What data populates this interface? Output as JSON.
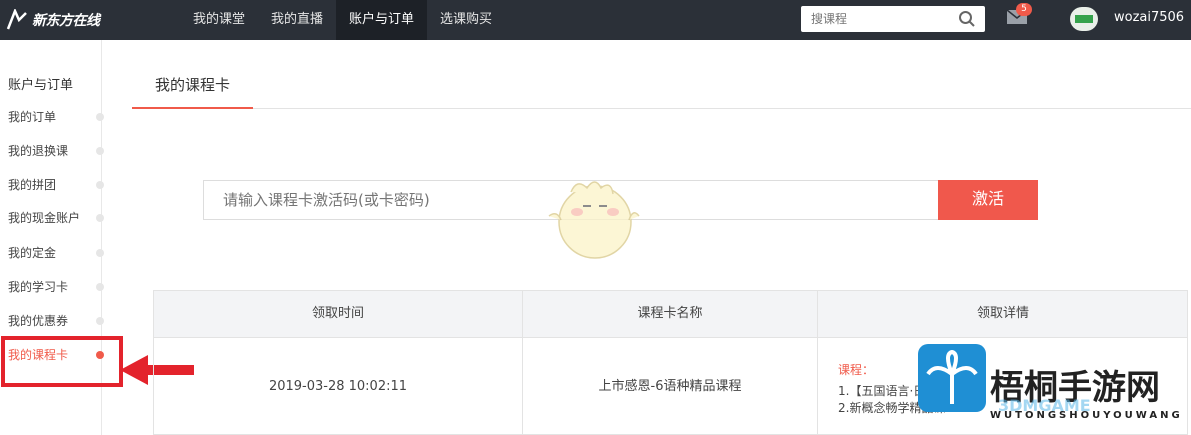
{
  "header": {
    "logo_text": "新东方在线",
    "nav": [
      "我的课堂",
      "我的直播",
      "账户与订单",
      "选课购买"
    ],
    "active_nav_index": 2,
    "search_placeholder": "搜课程",
    "mail_badge": "5",
    "username": "wozai7506"
  },
  "sidebar": {
    "title": "账户与订单",
    "items": [
      "我的订单",
      "我的退换课",
      "我的拼团",
      "我的现金账户",
      "我的定金",
      "我的学习卡",
      "我的优惠券",
      "我的课程卡"
    ],
    "active_index": 7
  },
  "main": {
    "tab": "我的课程卡",
    "activation_placeholder": "请输入课程卡激活码(或卡密码)",
    "activate_button": "激活",
    "table": {
      "headers": [
        "领取时间",
        "课程卡名称",
        "领取详情"
      ],
      "rows": [
        {
          "time": "2019-03-28 10:02:11",
          "name": "上市感恩-6语种精品课程",
          "detail_label": "课程：",
          "detail_lines": [
            "1.【五国语言·日语】日语",
            "2.新概念畅学精品课"
          ]
        }
      ]
    }
  },
  "watermark": {
    "title": "梧桐手游网",
    "brand": "3DMGAME",
    "subtitle": "WUTONGSHOUYOUWANG"
  },
  "colors": {
    "accent": "#f05a4a",
    "topbar": "#2b3038",
    "highlight": "#e3232c"
  }
}
